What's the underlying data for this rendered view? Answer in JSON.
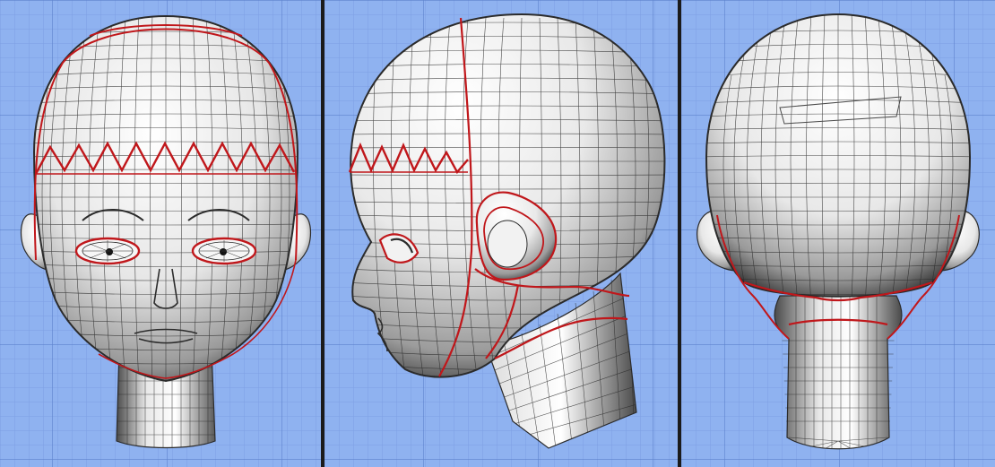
{
  "app": {
    "kind": "3d-modeling-viewport-layout"
  },
  "colors": {
    "background": "#8fb2f0",
    "grid_minor": "#7c9fe3",
    "grid_major": "#5d82cd",
    "divider": "#1b1b1b",
    "wireframe": "#2b2b2b",
    "seam": "#c0171b",
    "mesh_highlight": "#ffffff",
    "mesh_shadow": "#2a2a2a"
  },
  "viewports": [
    {
      "id": "front",
      "view": "front",
      "subject": "head-mesh",
      "shading": "smooth-shaded-wireframe",
      "seam_overlay": true
    },
    {
      "id": "side",
      "view": "left",
      "subject": "head-mesh",
      "shading": "smooth-shaded-wireframe",
      "seam_overlay": true
    },
    {
      "id": "back",
      "view": "back",
      "subject": "head-mesh",
      "shading": "smooth-shaded-wireframe",
      "seam_overlay": true
    }
  ]
}
